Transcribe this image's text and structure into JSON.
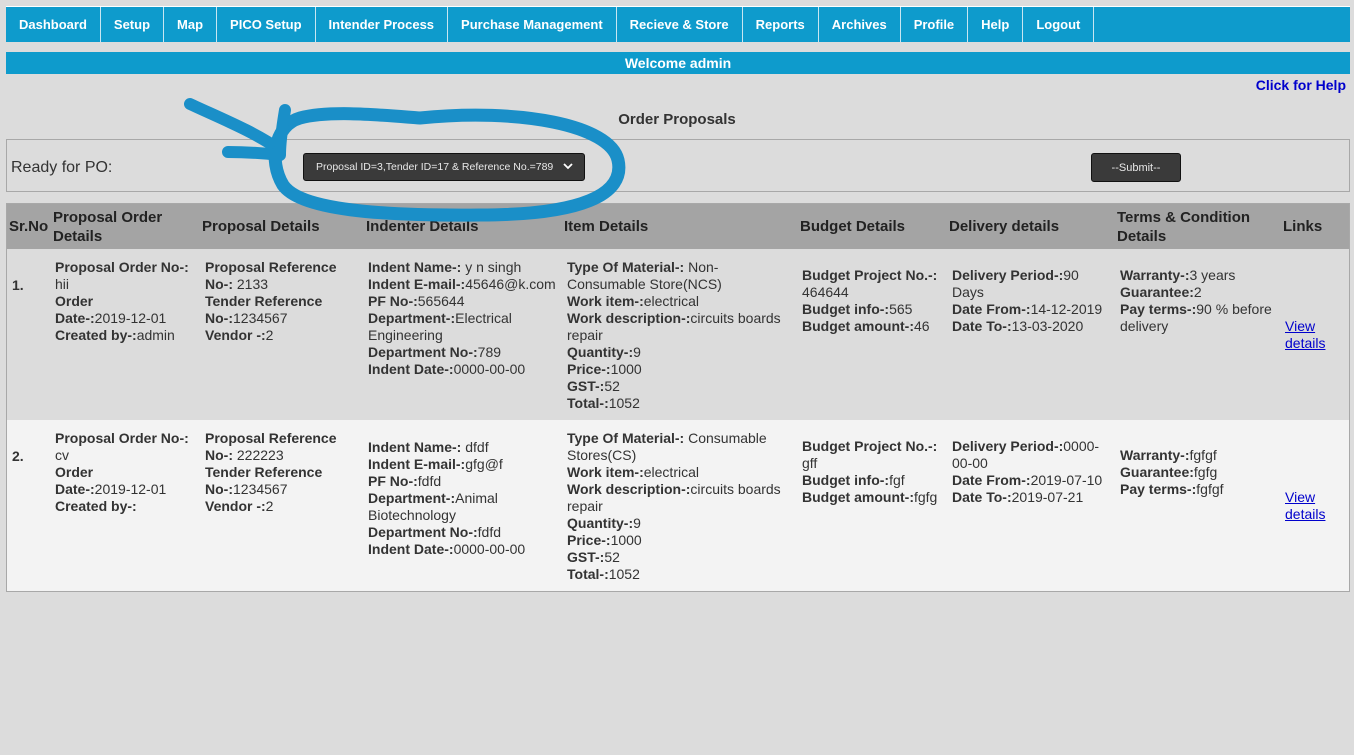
{
  "nav": [
    "Dashboard",
    "Setup",
    "Map",
    "PICO Setup",
    "Intender Process",
    "Purchase Management",
    "Recieve & Store",
    "Reports",
    "Archives",
    "Profile",
    "Help",
    "Logout"
  ],
  "welcome": "Welcome admin",
  "help_link": "Click for Help",
  "page_title": "Order Proposals",
  "po": {
    "label": "Ready for PO:",
    "selected": "Proposal ID=3,Tender ID=17 & Reference No.=789",
    "submit": "--Submit--"
  },
  "table": {
    "headers": {
      "sr": "Sr.No",
      "order": "Proposal Order Details",
      "proposal": "Proposal Details",
      "indenter": "Indenter Details",
      "item": "Item Details",
      "budget": "Budget Details",
      "delivery": "Delivery details",
      "terms": "Terms & Condition Details",
      "links": "Links"
    },
    "labels": {
      "order_no": "Proposal Order No-:",
      "order_date": "Date-:",
      "order_date_pre": "Order",
      "created_by": "Created by-:",
      "ref_no": "Proposal Reference No-:",
      "tender_ref": "Tender Reference No-:",
      "vendor": "Vendor -:",
      "indent_name": "Indent Name-:",
      "indent_email": "Indent E-mail-:",
      "pf_no": "PF No-:",
      "department": "Department-:",
      "dept_no": "Department No-:",
      "indent_date": "Indent Date-:",
      "type": "Type Of Material-:",
      "work_item": "Work item-:",
      "work_desc": "Work description-:",
      "quantity": "Quantity-:",
      "price": "Price-:",
      "gst": "GST-:",
      "total": "Total-:",
      "budget_project": "Budget Project No.-:",
      "budget_info": "Budget info-:",
      "budget_amount": "Budget amount-:",
      "delivery_period": "Delivery Period-:",
      "date_from": "Date From-:",
      "date_to": "Date To-:",
      "warranty": "Warranty-:",
      "guarantee": "Guarantee:",
      "pay_terms": "Pay terms-:",
      "view": "View details"
    },
    "rows": [
      {
        "sr": "1.",
        "order_no": "hii",
        "order_date": "2019-12-01",
        "created_by": "admin",
        "ref_no": "2133",
        "tender_ref": "1234567",
        "vendor": "2",
        "indent_name": "y n singh",
        "indent_email": "45646@k.com",
        "pf_no": "565644",
        "department": "Electrical Engineering",
        "dept_no": "789",
        "indent_date": "0000-00-00",
        "type": "Non-Consumable Store(NCS)",
        "work_item": "electrical",
        "work_desc": "circuits boards repair",
        "quantity": "9",
        "price": "1000",
        "gst": "52",
        "total": "1052",
        "budget_project": "464644",
        "budget_info": "565",
        "budget_amount": "46",
        "delivery_period": "90 Days",
        "date_from": "14-12-2019",
        "date_to": "13-03-2020",
        "warranty": "3 years",
        "guarantee": "2",
        "pay_terms": "90 % before delivery"
      },
      {
        "sr": "2.",
        "order_no": "cv",
        "order_date": "2019-12-01",
        "created_by": "",
        "ref_no": "222223",
        "tender_ref": "1234567",
        "vendor": "2",
        "indent_name": "dfdf",
        "indent_email": "gfg@f",
        "pf_no": "fdfd",
        "department": "Animal Biotechnology",
        "dept_no": "fdfd",
        "indent_date": "0000-00-00",
        "type": "Consumable Stores(CS)",
        "work_item": "electrical",
        "work_desc": "circuits boards repair",
        "quantity": "9",
        "price": "1000",
        "gst": "52",
        "total": "1052",
        "budget_project": "gff",
        "budget_info": "fgf",
        "budget_amount": "fgfg",
        "delivery_period": "0000-00-00",
        "date_from": "2019-07-10",
        "date_to": "2019-07-21",
        "warranty": "fgfgf",
        "guarantee": "fgfg",
        "pay_terms": "fgfgf"
      }
    ]
  },
  "colors": {
    "nav_bg": "#0e9bcc",
    "annotation": "#1a8fc8",
    "header_bg": "#a4a4a4",
    "link": "#0000cc"
  }
}
